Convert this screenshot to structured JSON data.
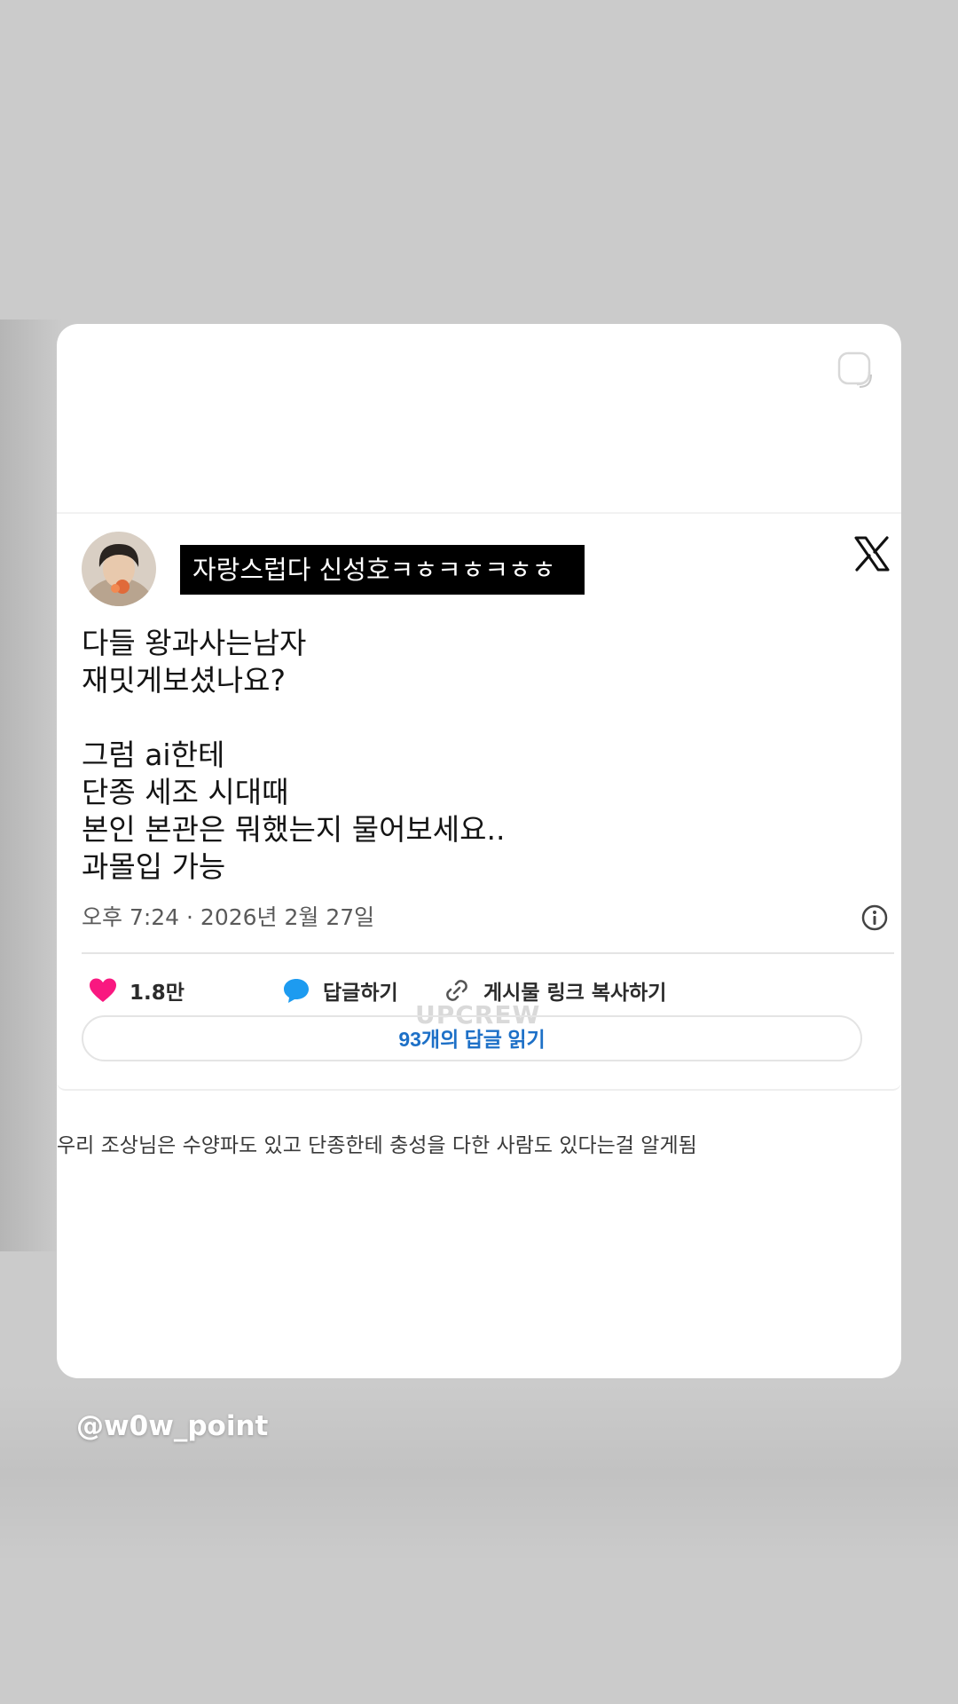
{
  "post": {
    "display_name": "자랑스럽다 신성호ㅋㅎㅋㅎㅋㅎㅎ",
    "body_lines": [
      "다들 왕과사는남자",
      "재밋게보셨나요?",
      "",
      "그럼 ai한테",
      "단종 세조 시대때",
      "본인 본관은 뭐했는지 물어보세요..",
      "과몰입 가능"
    ],
    "timestamp": "오후 7:24 · 2026년 2월 27일",
    "likes_count": "1.8만",
    "reply_label": "답글하기",
    "copy_link_label": "게시물 링크 복사하기",
    "read_replies_label": "93개의 답글 읽기",
    "watermark": "UPCREW"
  },
  "caption": "우리 조상님은 수양파도 있고 단종한테 충성을 다한 사람도 있다는걸 알게됨",
  "author_handle": "@w0w_point",
  "colors": {
    "like_pink": "#f91880",
    "reply_blue": "#1d9bf0",
    "link_blue": "#1d70c7",
    "background": "#cbcbcb"
  },
  "icons": [
    "sticker-icon",
    "avatar",
    "x-logo-icon",
    "info-icon",
    "heart-icon",
    "comment-icon",
    "link-icon"
  ]
}
